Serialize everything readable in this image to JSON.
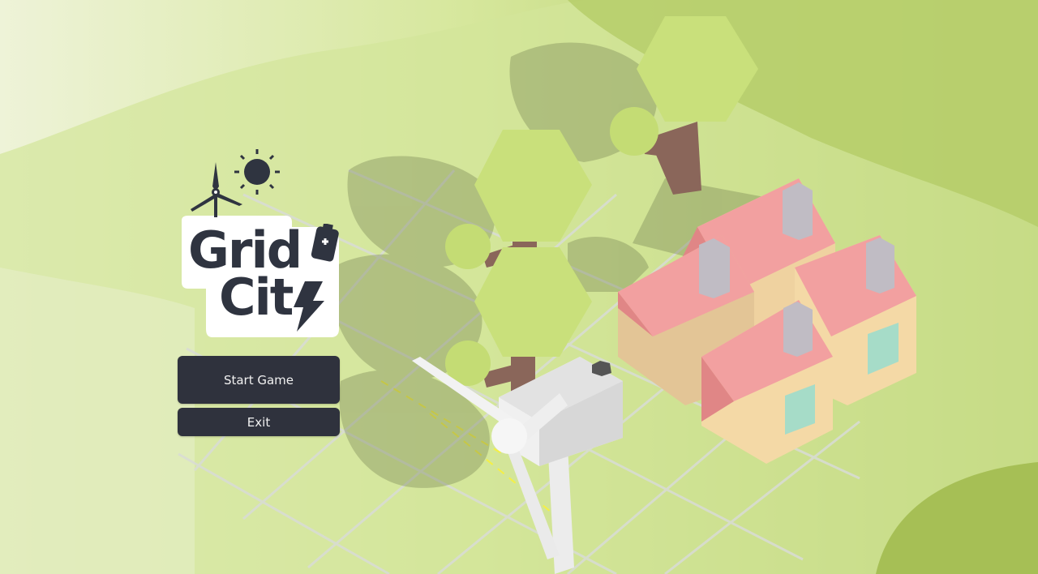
{
  "logo": {
    "line1": "Grid",
    "line2": "Cit"
  },
  "menu": {
    "start_label": "Start Game",
    "exit_label": "Exit"
  },
  "colors": {
    "button_bg": "#2f323d",
    "button_text": "#f1f1f1",
    "logo_ink": "#2f3440",
    "roof": "#e88f8f",
    "wall": "#f2d9a6",
    "window": "#a6dcc8",
    "tree": "#c8e07d",
    "trunk": "#8a665a"
  },
  "icons": [
    "wind-turbine-icon",
    "sun-icon",
    "battery-icon",
    "lightning-icon"
  ]
}
